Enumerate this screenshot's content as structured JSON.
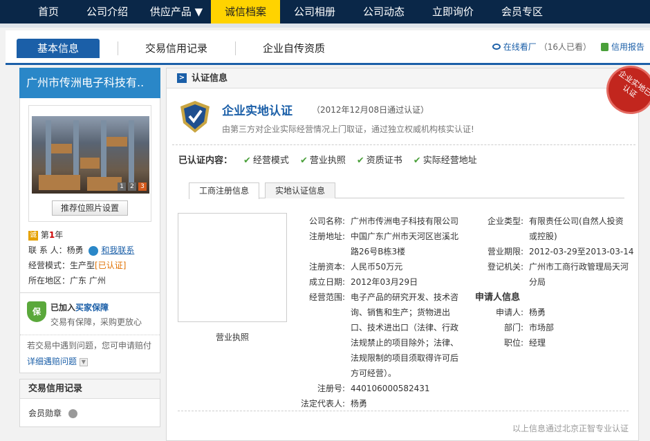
{
  "topnav": {
    "items": [
      {
        "label": "首页"
      },
      {
        "label": "公司介绍"
      },
      {
        "label": "供应产品 ▼"
      },
      {
        "label": "诚信档案",
        "active": true
      },
      {
        "label": "公司相册"
      },
      {
        "label": "公司动态"
      },
      {
        "label": "立即询价"
      },
      {
        "label": "会员专区"
      }
    ]
  },
  "subnav": {
    "tabs": [
      {
        "label": "基本信息",
        "active": true
      },
      {
        "label": "交易信用记录"
      },
      {
        "label": "企业自传资质"
      }
    ],
    "online_label": "在线看厂",
    "online_count": "（16人已看）",
    "report_label": "信用报告"
  },
  "left": {
    "company_name": "广州市传洲电子科技有..",
    "photo_pages": [
      "1",
      "2",
      "3"
    ],
    "photo_button": "推荐位照片设置",
    "cheng_icon": "诚",
    "year_prefix": "第",
    "year_num": "1",
    "year_suffix": "年",
    "contact_label": "联 系 人：",
    "contact_name": "杨勇",
    "contact_link": "和我联系",
    "mode_label": "经营模式：",
    "mode_value": "生产型",
    "mode_badge": "[已认证]",
    "region_label": "所在地区：",
    "region_value": "广东 广州",
    "buyer_shield": "保",
    "buyer_title_a": "已加入",
    "buyer_title_b": "买家保障",
    "buyer_desc": "交易有保障，采购更放心",
    "claim_text": "若交易中遇到问题，您可申请赔付",
    "claim_link": "详细遇赔问题",
    "credit_title": "交易信用记录",
    "medal_label": "会员勋章"
  },
  "main": {
    "section_title": "认证信息",
    "badge_text": "企业实地已认证",
    "cert_title": "企业实地认证",
    "cert_date": "（2012年12月08日通过认证）",
    "cert_desc": "由第三方对企业实际经营情况上门取证，通过独立权威机构核实认证!",
    "certified_label": "已认证内容：",
    "certified_items": [
      "经营模式",
      "营业执照",
      "资质证书",
      "实际经营地址"
    ],
    "tabs": [
      {
        "label": "工商注册信息",
        "active": true
      },
      {
        "label": "实地认证信息"
      }
    ],
    "licence_caption": "营业执照",
    "reg": {
      "company_name": {
        "k": "公司名称:",
        "v": "广州市传洲电子科技有限公司"
      },
      "address": {
        "k": "注册地址:",
        "v": "中国广东广州市天河区岜溪北路26号B栋3楼"
      },
      "capital": {
        "k": "注册资本:",
        "v": "人民币50万元"
      },
      "founded": {
        "k": "成立日期:",
        "v": "2012年03月29日"
      },
      "scope": {
        "k": "经营范围:",
        "v": "电子产品的研究开发、技术咨询、销售和生产；货物进出口、技术进出口（法律、行政法规禁止的项目除外；法律、法规限制的项目须取得许可后方可经营）。"
      },
      "reg_no": {
        "k": "注册号:",
        "v": "440106000582431"
      },
      "legal_rep": {
        "k": "法定代表人:",
        "v": "杨勇"
      },
      "type": {
        "k": "企业类型:",
        "v": "有限责任公司(自然人投资或控股)"
      },
      "period": {
        "k": "营业期限:",
        "v": "2012-03-29至2013-03-14"
      },
      "authority": {
        "k": "登记机关:",
        "v": "广州市工商行政管理局天河分局"
      }
    },
    "applicant_title": "申请人信息",
    "applicant": {
      "name": {
        "k": "申请人:",
        "v": "杨勇"
      },
      "dept": {
        "k": "部门:",
        "v": "市场部"
      },
      "role": {
        "k": "职位:",
        "v": "经理"
      }
    },
    "footer": "以上信息通过北京正智专业认证"
  }
}
